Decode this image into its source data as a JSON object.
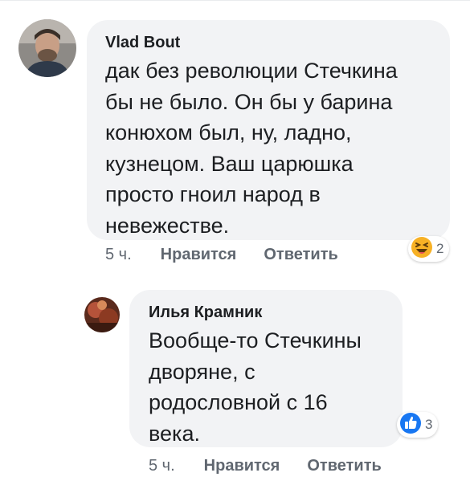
{
  "comments": [
    {
      "author": "Vlad Bout",
      "text_lines": [
        "дак без революции Стечкина",
        "бы не было. Он бы у барина",
        "конюхом был, ну, ладно,",
        "кузнецом. Ваш царюшка",
        "просто гноил народ в",
        "невежестве."
      ],
      "time": "5 ч.",
      "like_label": "Нравится",
      "reply_label": "Ответить",
      "reaction": {
        "icon": "haha-emoji-icon",
        "count": "2"
      }
    },
    {
      "author": "Илья Крамник",
      "text_lines": [
        "Вообще-то Стечкины",
        "дворяне, с",
        "родословной с 16",
        "века."
      ],
      "time": "5 ч.",
      "like_label": "Нравится",
      "reply_label": "Ответить",
      "reaction": {
        "icon": "thumbs-up-icon",
        "count": "3"
      }
    }
  ],
  "colors": {
    "bubble": "#f2f3f5",
    "meta_text": "#606770",
    "like_blue": "#1877f2",
    "haha_yellow": "#f7b125"
  }
}
